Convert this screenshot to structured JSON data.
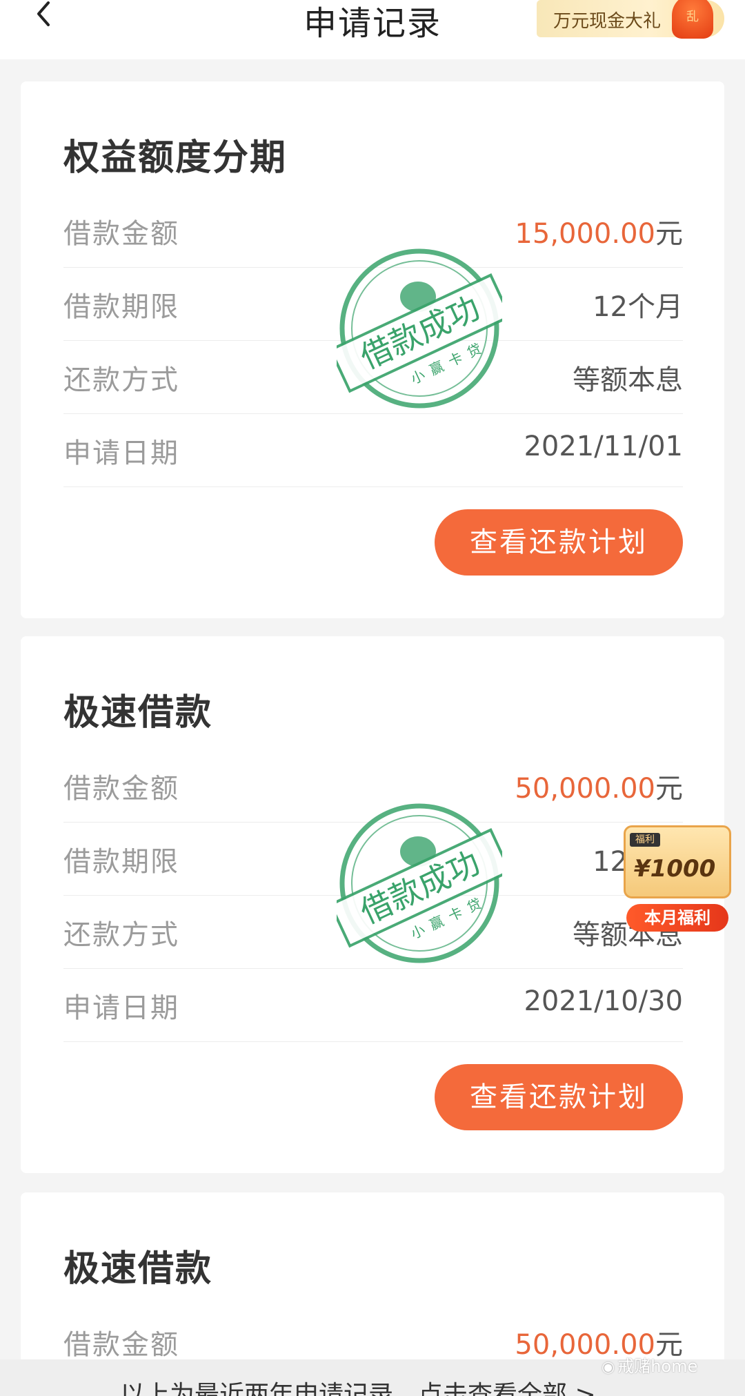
{
  "header": {
    "title": "申请记录",
    "promo": "万元现金大礼",
    "promo_envelope_char": "乱"
  },
  "cards": [
    {
      "title": "权益额度分期",
      "amount_label": "借款金额",
      "amount_value": "15,000.00",
      "amount_unit": "元",
      "term_label": "借款期限",
      "term_value": "12个月",
      "method_label": "还款方式",
      "method_value": "等额本息",
      "date_label": "申请日期",
      "date_value": "2021/11/01",
      "button": "查看还款计划"
    },
    {
      "title": "极速借款",
      "amount_label": "借款金额",
      "amount_value": "50,000.00",
      "amount_unit": "元",
      "term_label": "借款期限",
      "term_value": "12个月",
      "method_label": "还款方式",
      "method_value": "等额本息",
      "date_label": "申请日期",
      "date_value": "2021/10/30",
      "button": "查看还款计划"
    },
    {
      "title": "极速借款",
      "amount_label": "借款金额",
      "amount_value": "50,000.00",
      "amount_unit": "元"
    }
  ],
  "stamp": {
    "main": "借款成功",
    "sub": "小赢卡贷"
  },
  "float_bonus": {
    "tag": "福利",
    "amount": "¥1000",
    "caption": "本月福利"
  },
  "footer": {
    "text": "以上为最近两年申请记录，点击查看全部 >"
  },
  "watermark": "戒赌home",
  "colors": {
    "accent": "#f46a3b",
    "amount": "#e8663a",
    "stamp": "#3aa36b"
  }
}
